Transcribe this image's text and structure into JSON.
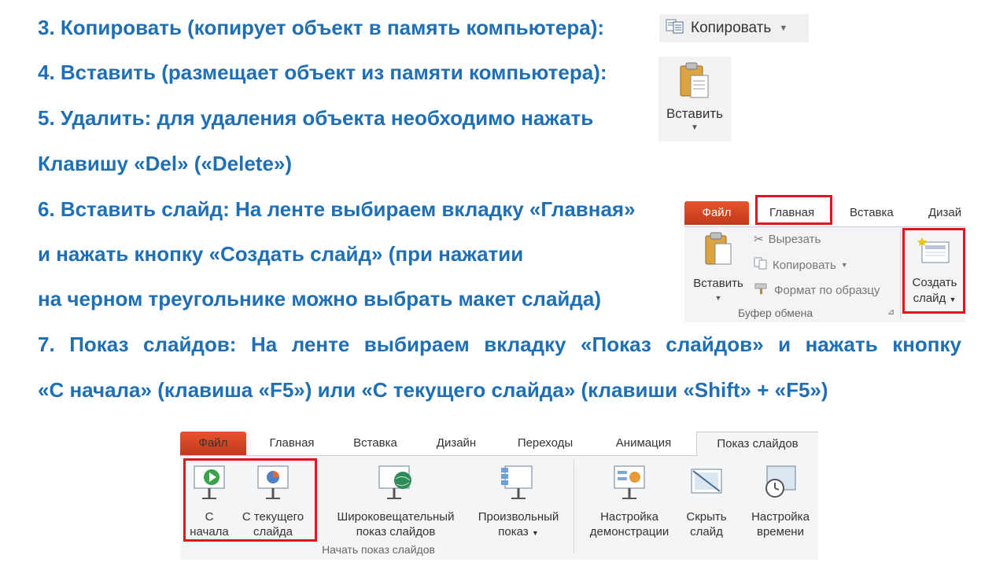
{
  "lines": [
    "3. Копировать (копирует объект в память компьютера):",
    "4. Вставить (размещает объект из памяти компьютера):",
    "5. Удалить: для удаления объекта необходимо нажать",
    "Клавишу «Del» («Delete»)",
    "6. Вставить слайд: На ленте выбираем вкладку «Главная»",
    "и нажать кнопку «Создать слайд» (при нажатии",
    "на черном треугольнике можно выбрать макет слайда)",
    "7. Показ слайдов:  На ленте выбираем вкладку «Показ слайдов» и нажать кнопку",
    "«С начала» (клавиша «F5») или «С текущего слайда» (клавиши «Shift» + «F5»)"
  ],
  "copy_button": {
    "label": "Копировать",
    "icon": "copy-icon"
  },
  "paste_button": {
    "label": "Вставить",
    "icon": "clipboard-paste-icon"
  },
  "ribbon_home": {
    "tabs": {
      "file": "Файл",
      "home": "Главная",
      "insert": "Вставка",
      "design": "Дизай"
    },
    "paste_label": "Вставить",
    "cut_label": "Вырезать",
    "copy_label": "Копировать",
    "format_label": "Формат по образцу",
    "group_label": "Буфер обмена",
    "new_slide_line1": "Создать",
    "new_slide_line2": "слайд"
  },
  "ribbon_slideshow": {
    "tabs": {
      "file": "Файл",
      "home": "Главная",
      "insert": "Вставка",
      "design": "Дизайн",
      "transitions": "Переходы",
      "animation": "Анимация",
      "slideshow": "Показ слайдов"
    },
    "buttons": {
      "from_start_1": "С",
      "from_start_2": "начала",
      "from_current_1": "С текущего",
      "from_current_2": "слайда",
      "broadcast_1": "Широковещательный",
      "broadcast_2": "показ слайдов",
      "custom_1": "Произвольный",
      "custom_2": "показ",
      "setup_1": "Настройка",
      "setup_2": "демонстрации",
      "hide_1": "Скрыть",
      "hide_2": "слайд",
      "timing_1": "Настройка",
      "timing_2": "времени"
    },
    "group_label": "Начать показ слайдов"
  },
  "colors": {
    "text_blue": "#1f6fb5",
    "highlight_red": "#e1141b",
    "file_tab": "#d9472b"
  }
}
